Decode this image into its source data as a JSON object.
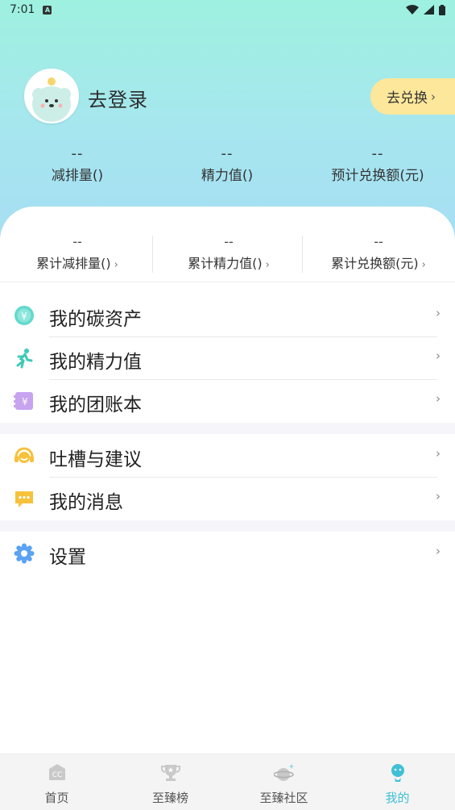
{
  "status_bar": {
    "time": "7:01",
    "notif_badge": "A"
  },
  "profile": {
    "login_label": "去登录",
    "redeem_button": "去兑换",
    "chevron": "›"
  },
  "stats": [
    {
      "value": "--",
      "label": "减排量()"
    },
    {
      "value": "--",
      "label": "精力值()"
    },
    {
      "value": "--",
      "label": "预计兑换额(元)"
    }
  ],
  "cumulative": [
    {
      "value": "--",
      "label": "累计减排量()"
    },
    {
      "value": "--",
      "label": "累计精力值()"
    },
    {
      "value": "--",
      "label": "累计兑换额(元)"
    }
  ],
  "menu_group_1": [
    {
      "label": "我的碳资产",
      "icon": "carbon-asset-icon"
    },
    {
      "label": "我的精力值",
      "icon": "runner-icon"
    },
    {
      "label": "我的团账本",
      "icon": "ledger-icon"
    }
  ],
  "menu_group_2": [
    {
      "label": "吐槽与建议",
      "icon": "feedback-headset-icon"
    },
    {
      "label": "我的消息",
      "icon": "message-icon"
    }
  ],
  "menu_group_3": [
    {
      "label": "设置",
      "icon": "settings-gear-icon"
    }
  ],
  "bottom_nav": [
    {
      "label": "首页",
      "icon": "home-cc-icon",
      "active": false
    },
    {
      "label": "至臻榜",
      "icon": "trophy-icon",
      "active": false
    },
    {
      "label": "至臻社区",
      "icon": "planet-icon",
      "active": false
    },
    {
      "label": "我的",
      "icon": "profile-icon",
      "active": true
    }
  ],
  "colors": {
    "hero_top": "#9ef1df",
    "hero_bottom": "#a6dcf4",
    "redeem_bg": "#fde79a",
    "active_tab": "#3fc0d6"
  }
}
